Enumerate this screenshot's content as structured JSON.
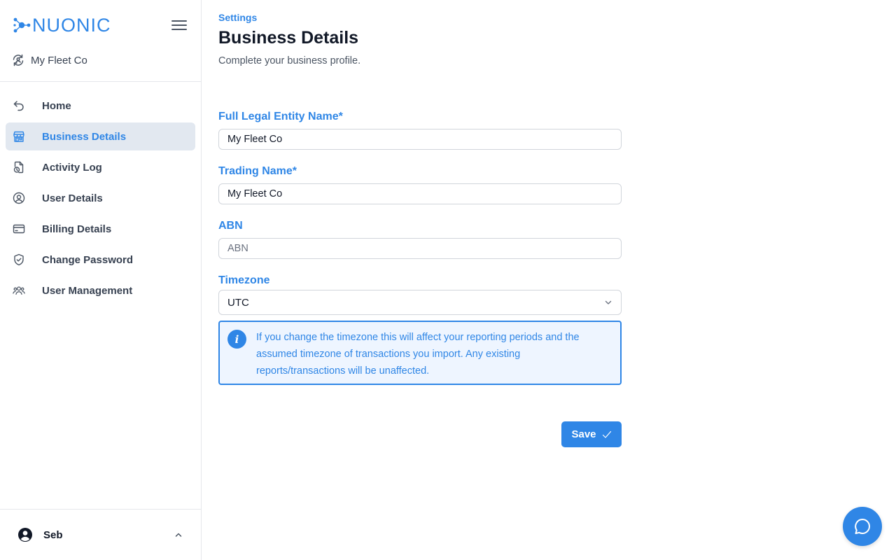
{
  "brand": {
    "logo_text": "NUONIC",
    "accent": "#2f86e6"
  },
  "sidebar": {
    "org_name": "My Fleet Co",
    "items": [
      {
        "label": "Home",
        "icon": "undo-arrow-icon",
        "active": false
      },
      {
        "label": "Business Details",
        "icon": "storefront-icon",
        "active": true
      },
      {
        "label": "Activity Log",
        "icon": "document-clock-icon",
        "active": false
      },
      {
        "label": "User Details",
        "icon": "user-circle-icon",
        "active": false
      },
      {
        "label": "Billing Details",
        "icon": "credit-card-icon",
        "active": false
      },
      {
        "label": "Change Password",
        "icon": "shield-check-icon",
        "active": false
      },
      {
        "label": "User Management",
        "icon": "users-icon",
        "active": false
      }
    ],
    "user": {
      "name": "Seb"
    }
  },
  "page": {
    "breadcrumb": "Settings",
    "title": "Business Details",
    "subtitle": "Complete your business profile."
  },
  "form": {
    "legal_name": {
      "label": "Full Legal Entity Name*",
      "value": "My Fleet Co"
    },
    "trading_name": {
      "label": "Trading Name*",
      "value": "My Fleet Co"
    },
    "abn": {
      "label": "ABN",
      "value": "",
      "placeholder": "ABN"
    },
    "timezone": {
      "label": "Timezone",
      "value": "UTC"
    },
    "info_text": "If you change the timezone this will affect your reporting periods and the assumed timezone of transactions you import. Any existing reports/transactions will be unaffected.",
    "save_label": "Save"
  }
}
